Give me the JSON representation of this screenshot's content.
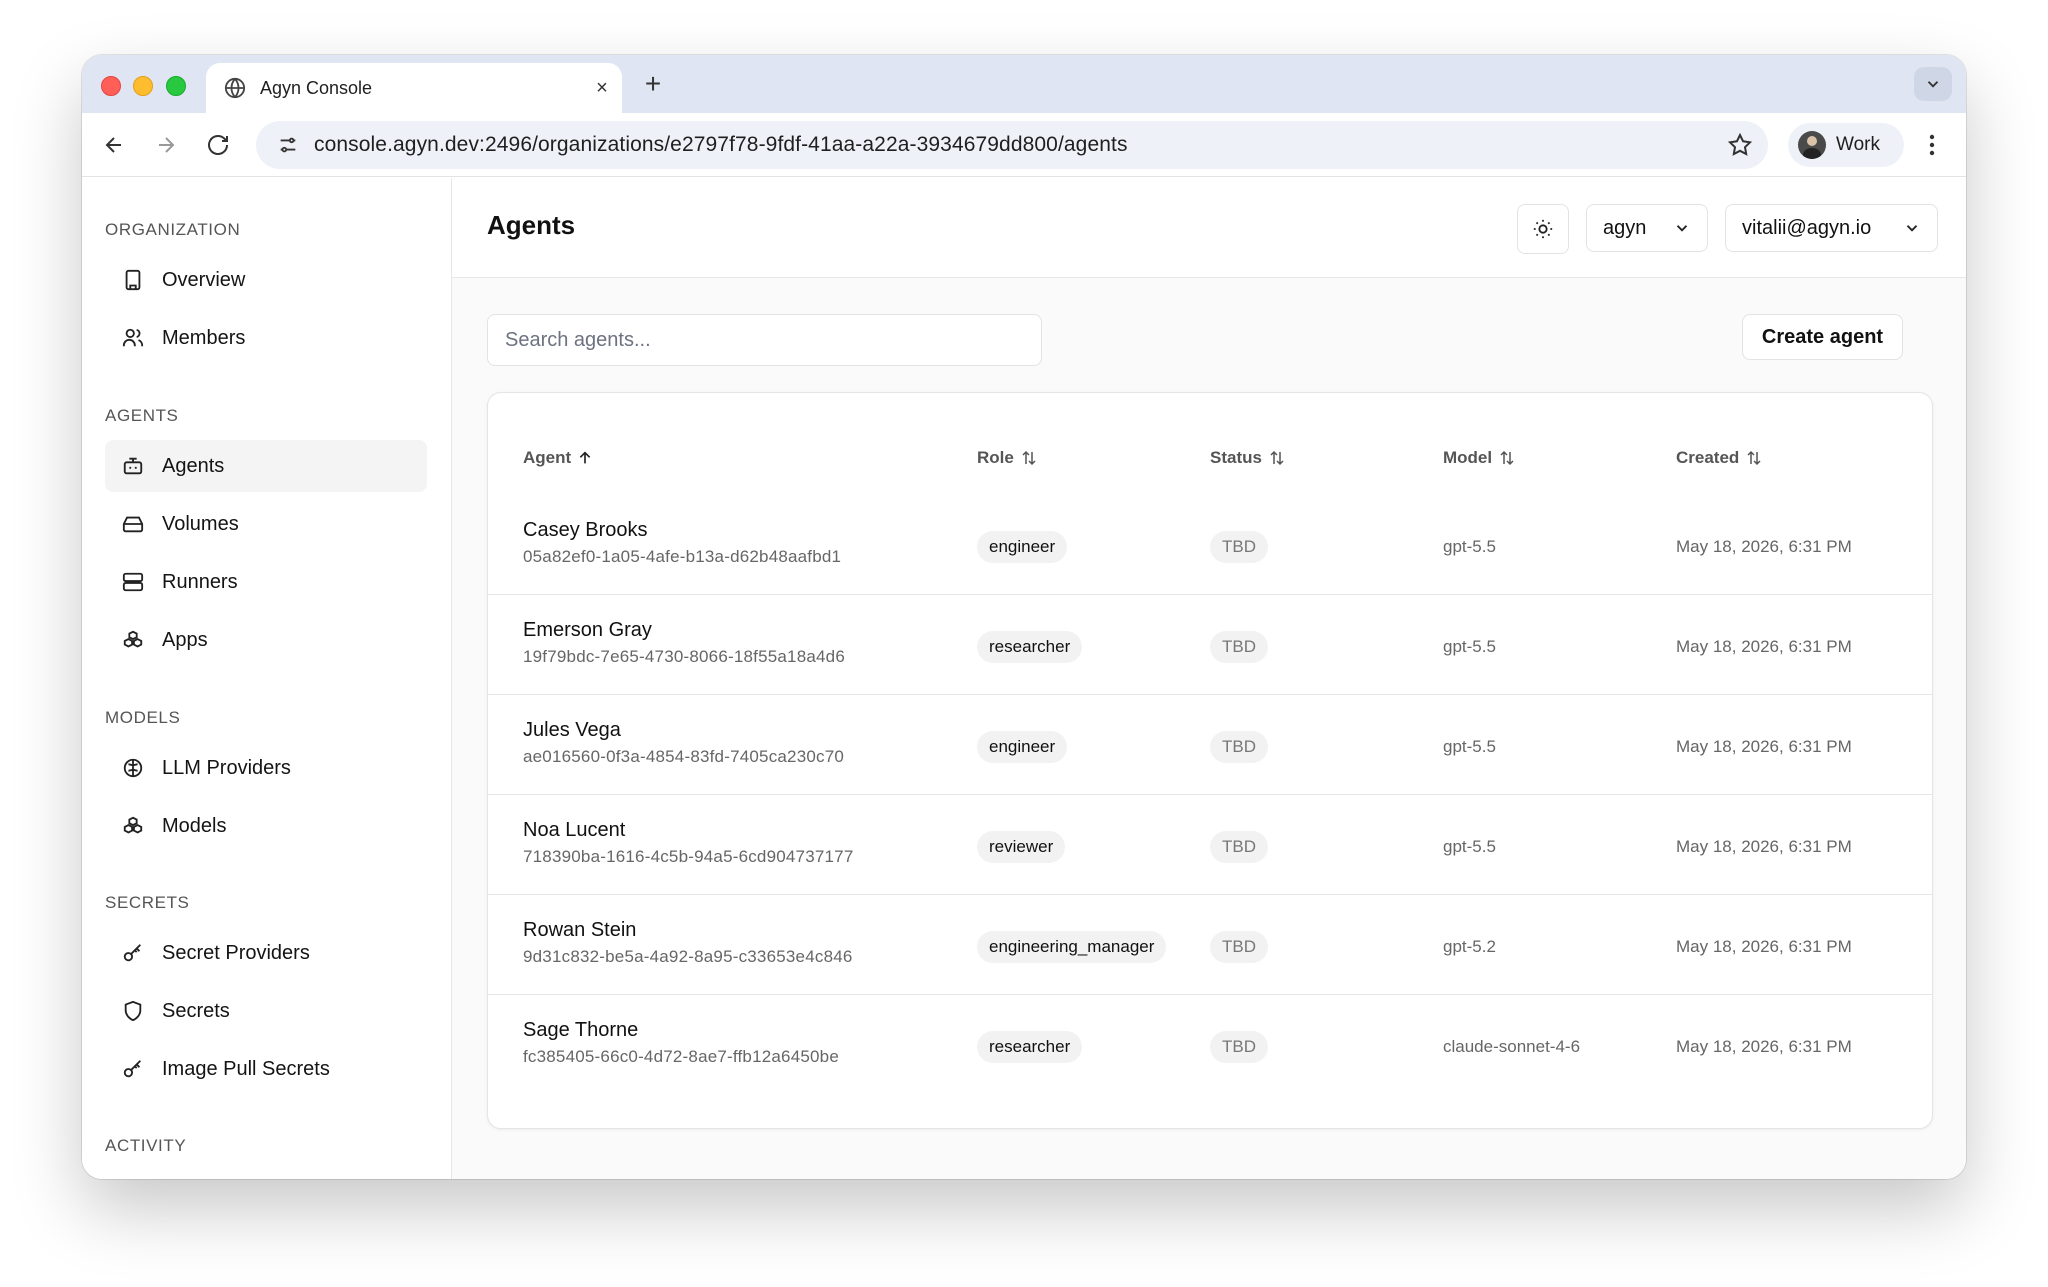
{
  "browser": {
    "tab_title": "Agyn Console",
    "new_tab_label": "+",
    "tab_close_label": "×",
    "url": "console.agyn.dev:2496/organizations/e2797f78-9fdf-41aa-a22a-3934679dd800/agents",
    "profile_label": "Work"
  },
  "sidebar": {
    "sections": [
      {
        "label": "ORGANIZATION",
        "items": [
          {
            "label": "Overview",
            "icon": "building-icon"
          },
          {
            "label": "Members",
            "icon": "users-icon"
          }
        ]
      },
      {
        "label": "AGENTS",
        "items": [
          {
            "label": "Agents",
            "icon": "bot-icon",
            "active": true
          },
          {
            "label": "Volumes",
            "icon": "hard-drive-icon"
          },
          {
            "label": "Runners",
            "icon": "server-icon"
          },
          {
            "label": "Apps",
            "icon": "boxes-icon"
          }
        ]
      },
      {
        "label": "MODELS",
        "items": [
          {
            "label": "LLM Providers",
            "icon": "brain-icon"
          },
          {
            "label": "Models",
            "icon": "boxes-icon"
          }
        ]
      },
      {
        "label": "SECRETS",
        "items": [
          {
            "label": "Secret Providers",
            "icon": "key-icon"
          },
          {
            "label": "Secrets",
            "icon": "shield-icon"
          },
          {
            "label": "Image Pull Secrets",
            "icon": "key-icon"
          }
        ]
      },
      {
        "label": "ACTIVITY",
        "items": []
      }
    ]
  },
  "header": {
    "title": "Agents",
    "org_select": "agyn",
    "user_select": "vitalii@agyn.io"
  },
  "toolbar": {
    "search_placeholder": "Search agents...",
    "create_label": "Create agent"
  },
  "table": {
    "columns": [
      {
        "label": "Agent",
        "sort": "asc"
      },
      {
        "label": "Role",
        "sort": "none"
      },
      {
        "label": "Status",
        "sort": "none"
      },
      {
        "label": "Model",
        "sort": "none"
      },
      {
        "label": "Created",
        "sort": "none"
      }
    ],
    "rows": [
      {
        "name": "Casey Brooks",
        "id": "05a82ef0-1a05-4afe-b13a-d62b48aafbd1",
        "role": "engineer",
        "status": "TBD",
        "model": "gpt-5.5",
        "created": "May 18, 2026, 6:31 PM"
      },
      {
        "name": "Emerson Gray",
        "id": "19f79bdc-7e65-4730-8066-18f55a18a4d6",
        "role": "researcher",
        "status": "TBD",
        "model": "gpt-5.5",
        "created": "May 18, 2026, 6:31 PM"
      },
      {
        "name": "Jules Vega",
        "id": "ae016560-0f3a-4854-83fd-7405ca230c70",
        "role": "engineer",
        "status": "TBD",
        "model": "gpt-5.5",
        "created": "May 18, 2026, 6:31 PM"
      },
      {
        "name": "Noa Lucent",
        "id": "718390ba-1616-4c5b-94a5-6cd904737177",
        "role": "reviewer",
        "status": "TBD",
        "model": "gpt-5.5",
        "created": "May 18, 2026, 6:31 PM"
      },
      {
        "name": "Rowan Stein",
        "id": "9d31c832-be5a-4a92-8a95-c33653e4c846",
        "role": "engineering_manager",
        "status": "TBD",
        "model": "gpt-5.2",
        "created": "May 18, 2026, 6:31 PM"
      },
      {
        "name": "Sage Thorne",
        "id": "fc385405-66c0-4d72-8ae7-ffb12a6450be",
        "role": "researcher",
        "status": "TBD",
        "model": "claude-sonnet-4-6",
        "created": "May 18, 2026, 6:31 PM"
      }
    ]
  }
}
